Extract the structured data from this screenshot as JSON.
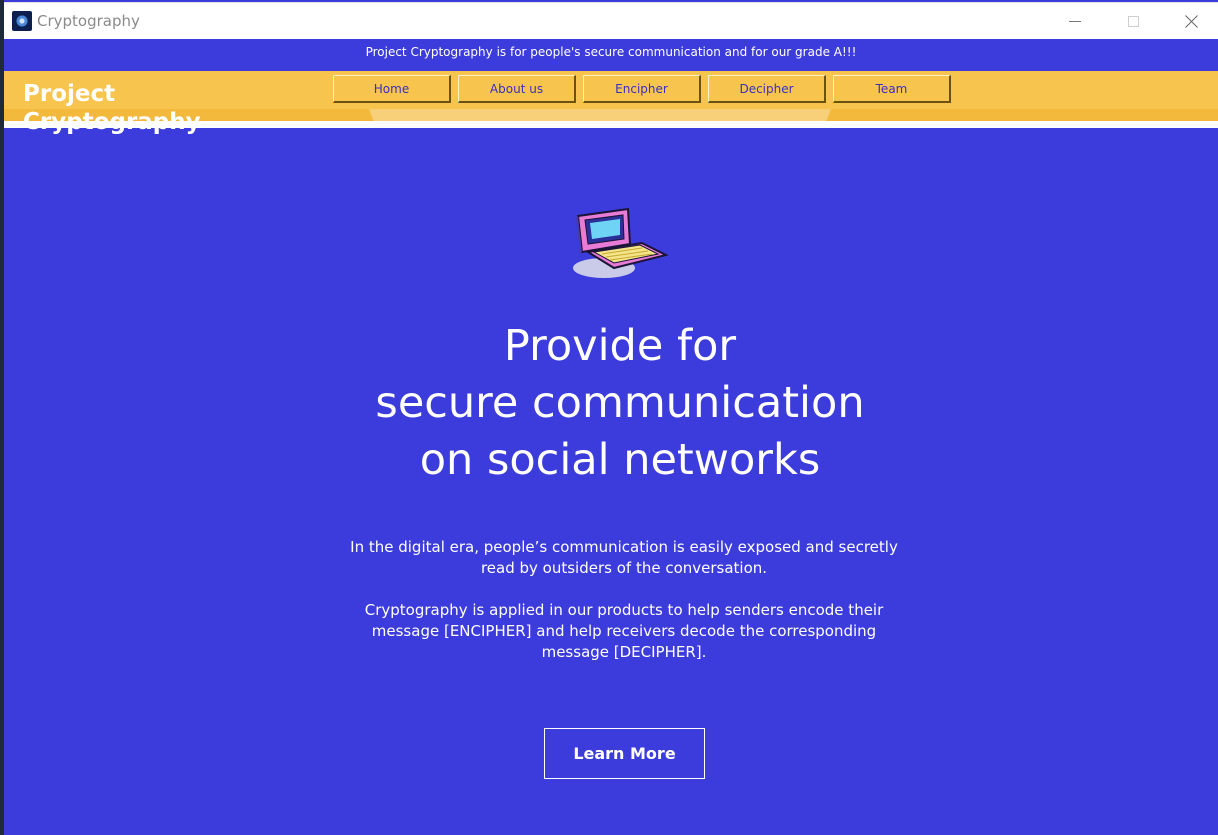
{
  "window": {
    "title": "Cryptography"
  },
  "announcement": "Project Cryptography is for people's secure communication and for our grade A!!!",
  "brand": {
    "line1": "Project",
    "line2": "Cryptography"
  },
  "nav": {
    "items": [
      {
        "label": "Home"
      },
      {
        "label": "About us"
      },
      {
        "label": "Encipher"
      },
      {
        "label": "Decipher"
      },
      {
        "label": "Team"
      }
    ]
  },
  "hero": {
    "icon": "laptop-icon",
    "headline": [
      "Provide for",
      "secure communication",
      "on social networks"
    ],
    "paragraphs": [
      "In the digital era, people’s communication is easily exposed and secretly read by outsiders of the conversation.",
      "Cryptography is applied in our products to help senders encode their message [ENCIPHER] and help receivers decode the corresponding message [DECIPHER]."
    ],
    "cta_label": "Learn More"
  },
  "colors": {
    "background": "#3c3bdc",
    "navbar": "#f7c54e",
    "nav_text": "#3b2fbf",
    "text": "#ffffff"
  }
}
